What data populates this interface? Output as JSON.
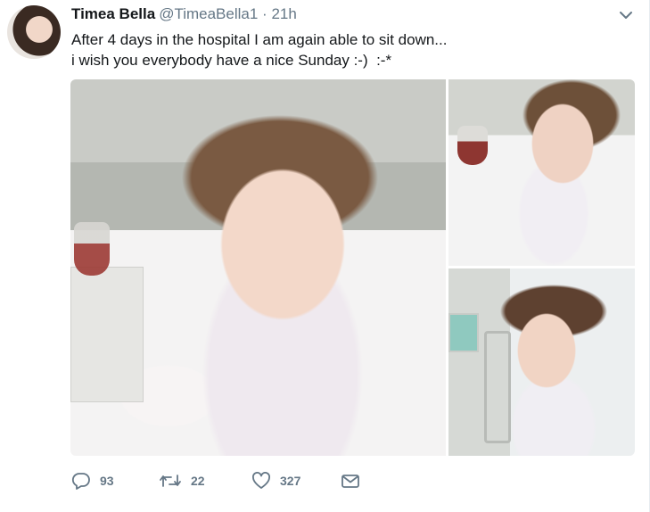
{
  "author": {
    "name": "Timea Bella",
    "handle": "@TimeaBella1",
    "separator": "·",
    "time": "21h"
  },
  "tweet": {
    "lines": [
      "After 4 days in the hospital I am again able to sit down...",
      "i wish you everybody have a nice Sunday :-)  :-*"
    ]
  },
  "media": {
    "photo_count": 3
  },
  "actions": {
    "replies": "93",
    "retweets": "22",
    "likes": "327"
  },
  "icons": {
    "more": "chevron-down-icon",
    "reply": "reply-icon",
    "retweet": "retweet-icon",
    "like": "heart-icon",
    "dm": "envelope-icon"
  },
  "colors": {
    "text": "#14171a",
    "secondary": "#657786"
  }
}
